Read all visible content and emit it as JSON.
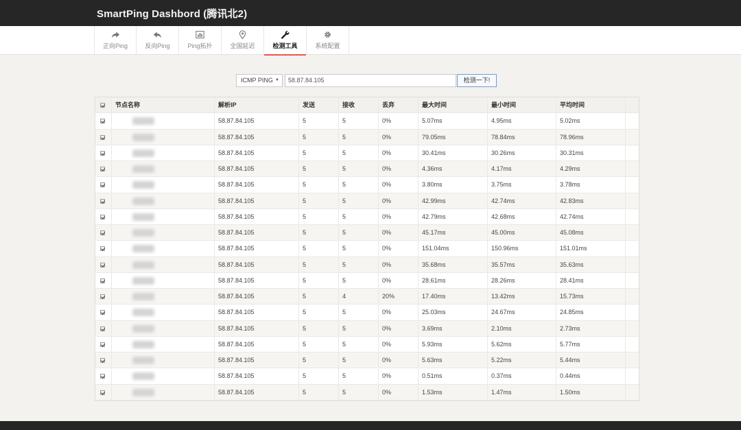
{
  "app": {
    "title": "SmartPing Dashbord (腾讯北2)"
  },
  "nav": [
    {
      "label": "正向Ping",
      "icon": "forward-arrow-icon"
    },
    {
      "label": "反向Ping",
      "icon": "reply-arrow-icon"
    },
    {
      "label": "Ping拓扑",
      "icon": "chart-icon"
    },
    {
      "label": "全国延迟",
      "icon": "map-pin-icon"
    },
    {
      "label": "检测工具",
      "icon": "wrench-icon",
      "active": true
    },
    {
      "label": "系统配置",
      "icon": "gear-icon"
    }
  ],
  "tool": {
    "select_value": "ICMP PING",
    "input_value": "58.87.84.105",
    "button_label": "检测一下!"
  },
  "table": {
    "headers": [
      "节点名称",
      "解析IP",
      "发送",
      "接收",
      "丢弃",
      "最大时间",
      "最小时间",
      "平均时间"
    ],
    "rows": [
      [
        "58.87.84.105",
        "5",
        "5",
        "0%",
        "5.07ms",
        "4.95ms",
        "5.02ms"
      ],
      [
        "58.87.84.105",
        "5",
        "5",
        "0%",
        "79.05ms",
        "78.84ms",
        "78.96ms"
      ],
      [
        "58.87.84.105",
        "5",
        "5",
        "0%",
        "30.41ms",
        "30.26ms",
        "30.31ms"
      ],
      [
        "58.87.84.105",
        "5",
        "5",
        "0%",
        "4.36ms",
        "4.17ms",
        "4.29ms"
      ],
      [
        "58.87.84.105",
        "5",
        "5",
        "0%",
        "3.80ms",
        "3.75ms",
        "3.78ms"
      ],
      [
        "58.87.84.105",
        "5",
        "5",
        "0%",
        "42.99ms",
        "42.74ms",
        "42.83ms"
      ],
      [
        "58.87.84.105",
        "5",
        "5",
        "0%",
        "42.79ms",
        "42.68ms",
        "42.74ms"
      ],
      [
        "58.87.84.105",
        "5",
        "5",
        "0%",
        "45.17ms",
        "45.00ms",
        "45.08ms"
      ],
      [
        "58.87.84.105",
        "5",
        "5",
        "0%",
        "151.04ms",
        "150.96ms",
        "151.01ms"
      ],
      [
        "58.87.84.105",
        "5",
        "5",
        "0%",
        "35.68ms",
        "35.57ms",
        "35.63ms"
      ],
      [
        "58.87.84.105",
        "5",
        "5",
        "0%",
        "28.61ms",
        "28.26ms",
        "28.41ms"
      ],
      [
        "58.87.84.105",
        "5",
        "4",
        "20%",
        "17.40ms",
        "13.42ms",
        "15.73ms"
      ],
      [
        "58.87.84.105",
        "5",
        "5",
        "0%",
        "25.03ms",
        "24.67ms",
        "24.85ms"
      ],
      [
        "58.87.84.105",
        "5",
        "5",
        "0%",
        "3.69ms",
        "2.10ms",
        "2.73ms"
      ],
      [
        "58.87.84.105",
        "5",
        "5",
        "0%",
        "5.93ms",
        "5.62ms",
        "5.77ms"
      ],
      [
        "58.87.84.105",
        "5",
        "5",
        "0%",
        "5.63ms",
        "5.22ms",
        "5.44ms"
      ],
      [
        "58.87.84.105",
        "5",
        "5",
        "0%",
        "0.51ms",
        "0.37ms",
        "0.44ms"
      ],
      [
        "58.87.84.105",
        "5",
        "5",
        "0%",
        "1.53ms",
        "1.47ms",
        "1.50ms"
      ]
    ]
  }
}
